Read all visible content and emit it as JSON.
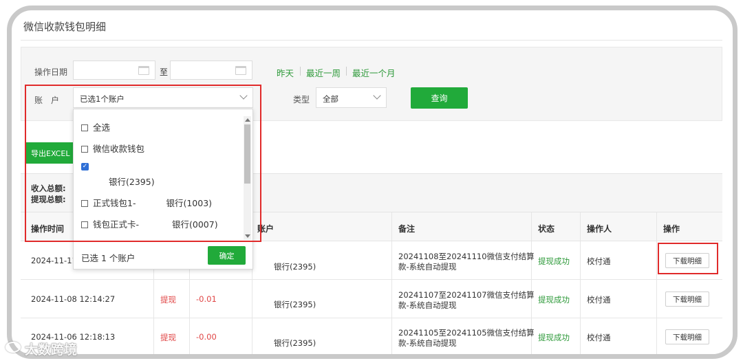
{
  "page": {
    "title": "微信收款钱包明细"
  },
  "filter": {
    "date_label": "操作日期",
    "date_to": "至",
    "quick_links": [
      "昨天",
      "最近一周",
      "最近一个月"
    ],
    "account_label": "账　户",
    "account_value": "已选1个账户",
    "type_label": "类型",
    "type_value": "全部",
    "query_button": "查询"
  },
  "actions": {
    "export_button": "导出EXCEL"
  },
  "summary": {
    "income_label": "收入总额:",
    "withdraw_label": "提现总额:"
  },
  "table": {
    "columns": [
      "操作时间",
      "账户",
      "备注",
      "状态",
      "操作人",
      "操作"
    ],
    "rows": [
      {
        "time": "2024-11-11",
        "type": "",
        "amount": "",
        "account": "银行(2395)",
        "note_line1": "20241108至20241110微信支付结算",
        "note_line2": "款-系统自动提现",
        "status": "提现成功",
        "operator": "校付通",
        "action": "下载明细"
      },
      {
        "time": "2024-11-08 12:14:27",
        "type": "提现",
        "amount": "-0.01",
        "account": "银行(2395)",
        "note_line1": "20241107至20241107微信支付结算",
        "note_line2": "款-系统自动提现",
        "status": "提现成功",
        "operator": "校付通",
        "action": "下载明细"
      },
      {
        "time": "2024-11-06 12:18:13",
        "type": "提现",
        "amount": "-0.00",
        "account": "银行(2395)",
        "note_line1": "20241105至20241105微信支付结算",
        "note_line2": "款-系统自动提现",
        "status": "提现成功",
        "operator": "校付通",
        "action": "下载明细"
      }
    ]
  },
  "dropdown": {
    "options": [
      {
        "label": "全选",
        "checked": false
      },
      {
        "label": "微信收款钱包",
        "checked": false
      },
      {
        "label": "银行(2395)",
        "checked": true
      },
      {
        "label": "正式钱包1-",
        "suffix": "银行(1003)",
        "checked": false
      },
      {
        "label": "钱包正式卡-",
        "suffix": "银行(0007)",
        "checked": false
      }
    ],
    "selected_text": "已选 1 个账户",
    "confirm_button": "确定"
  },
  "watermark": "大数跨境",
  "colors": {
    "accent": "#21aa3a",
    "link": "#2e9a3a",
    "negative": "#e04545",
    "highlight": "#e02a2a",
    "checkbox": "#2f6fd6"
  }
}
